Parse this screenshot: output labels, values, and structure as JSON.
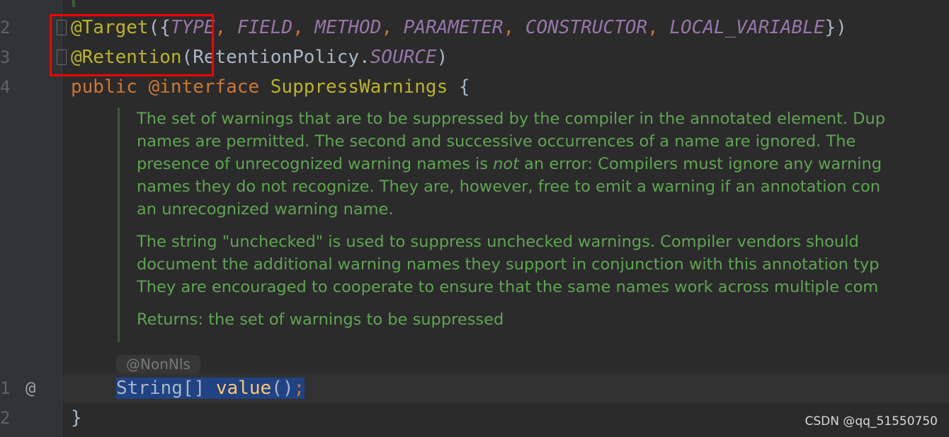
{
  "gutter": {
    "line_numbers": [
      "2",
      "3",
      "4",
      "1",
      "2"
    ],
    "override_marker": "@"
  },
  "code": {
    "line1": {
      "annotation": "@Target",
      "open": "({",
      "c1": "TYPE",
      "s1": ", ",
      "c2": "FIELD",
      "s2": ", ",
      "c3": "METHOD",
      "s3": ", ",
      "c4": "PARAMETER",
      "s4": ", ",
      "c5": "CONSTRUCTOR",
      "s5": ", ",
      "c6": "LOCAL_VARIABLE",
      "close": "})"
    },
    "line2": {
      "annotation": "@Retention",
      "open": "(RetentionPolicy.",
      "c1": "SOURCE",
      "close": ")"
    },
    "line3": {
      "kw1": "public",
      "kw2": " @interface ",
      "name": "SuppressWarnings",
      "brace": " {"
    },
    "method": {
      "type": "String[] ",
      "name": "value",
      "parens": "()",
      "semi": ";"
    },
    "closing": "}"
  },
  "doc": {
    "p1": [
      "The set of warnings that are to be suppressed by the compiler in the annotated element. Dup",
      "names are permitted. The second and successive occurrences of a name are ignored. The"
    ],
    "p1_line3_a": "presence of unrecognized warning names is ",
    "p1_line3_em": "not",
    "p1_line3_b": " an error: Compilers must ignore any warning",
    "p1_rest": [
      "names they do not recognize. They are, however, free to emit a warning if an annotation con",
      "an unrecognized warning name."
    ],
    "p2": [
      "The string \"unchecked\" is used to suppress unchecked warnings. Compiler vendors should",
      "document the additional warning names they support in conjunction with this annotation typ",
      "They are encouraged to cooperate to ensure that the same names work across multiple com"
    ],
    "returns": "Returns: the set of warnings to be suppressed"
  },
  "inlay_hint": "@NonNls",
  "watermark": "CSDN @qq_51550750",
  "colors": {
    "annotation": "#bbb529",
    "keyword": "#cc7832",
    "constant": "#9876aa",
    "doc": "#5fa552",
    "highlight_box": "#ff0000",
    "selection": "#214283"
  }
}
